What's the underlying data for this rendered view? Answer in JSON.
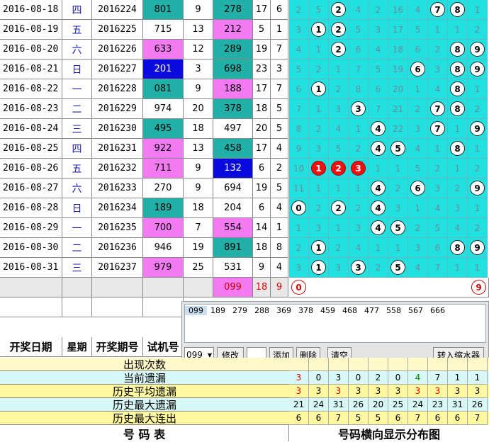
{
  "rows": [
    {
      "date": "2016-08-18",
      "wk": "四",
      "issue": "2016224",
      "test": "801",
      "s1": "9",
      "pick": "278",
      "s2": "17",
      "s3": "6",
      "cells": [
        "2",
        "5",
        "2",
        "4",
        "2",
        "16",
        "4",
        "7",
        "8",
        "1"
      ],
      "balls": [
        2,
        7,
        8
      ],
      "hl_test": "t",
      "hl_pick": "t"
    },
    {
      "date": "2016-08-19",
      "wk": "五",
      "issue": "2016225",
      "test": "715",
      "s1": "13",
      "pick": "212",
      "s2": "5",
      "s3": "1",
      "cells": [
        "3",
        "1",
        "2",
        "5",
        "3",
        "17",
        "5",
        "1",
        "1",
        "2"
      ],
      "balls": [
        1,
        2
      ],
      "hl_test": "",
      "hl_pick": "p"
    },
    {
      "date": "2016-08-20",
      "wk": "六",
      "issue": "2016226",
      "test": "633",
      "s1": "12",
      "pick": "289",
      "s2": "19",
      "s3": "7",
      "cells": [
        "4",
        "1",
        "2",
        "6",
        "4",
        "18",
        "6",
        "2",
        "8",
        "9"
      ],
      "balls": [
        2,
        8,
        9
      ],
      "hl_test": "p",
      "hl_pick": "t"
    },
    {
      "date": "2016-08-21",
      "wk": "日",
      "issue": "2016227",
      "test": "201",
      "s1": "3",
      "pick": "698",
      "s2": "23",
      "s3": "3",
      "cells": [
        "5",
        "2",
        "1",
        "7",
        "5",
        "19",
        "6",
        "3",
        "8",
        "9"
      ],
      "balls": [
        6,
        8,
        9
      ],
      "hl_test": "b",
      "hl_pick": "t"
    },
    {
      "date": "2016-08-22",
      "wk": "一",
      "issue": "2016228",
      "test": "081",
      "s1": "9",
      "pick": "188",
      "s2": "17",
      "s3": "7",
      "cells": [
        "6",
        "1",
        "2",
        "8",
        "6",
        "20",
        "1",
        "4",
        "8",
        "1"
      ],
      "balls": [
        1,
        8
      ],
      "hl_test": "t",
      "hl_pick": "p"
    },
    {
      "date": "2016-08-23",
      "wk": "二",
      "issue": "2016229",
      "test": "974",
      "s1": "20",
      "pick": "378",
      "s2": "18",
      "s3": "5",
      "cells": [
        "7",
        "1",
        "3",
        "3",
        "7",
        "21",
        "2",
        "7",
        "8",
        "2"
      ],
      "balls": [
        3,
        7,
        8
      ],
      "hl_test": "",
      "hl_pick": "t"
    },
    {
      "date": "2016-08-24",
      "wk": "三",
      "issue": "2016230",
      "test": "495",
      "s1": "18",
      "pick": "497",
      "s2": "20",
      "s3": "5",
      "cells": [
        "8",
        "2",
        "4",
        "1",
        "4",
        "22",
        "3",
        "7",
        "1",
        "9"
      ],
      "balls": [
        4,
        7,
        9
      ],
      "hl_test": "t",
      "hl_pick": ""
    },
    {
      "date": "2016-08-25",
      "wk": "四",
      "issue": "2016231",
      "test": "922",
      "s1": "13",
      "pick": "458",
      "s2": "17",
      "s3": "4",
      "cells": [
        "9",
        "3",
        "5",
        "2",
        "4",
        "5",
        "4",
        "1",
        "8",
        "1"
      ],
      "balls": [
        4,
        5,
        8
      ],
      "hl_test": "p",
      "hl_pick": "t"
    },
    {
      "date": "2016-08-26",
      "wk": "五",
      "issue": "2016232",
      "test": "711",
      "s1": "9",
      "pick": "132",
      "s2": "6",
      "s3": "2",
      "cells": [
        "10",
        "1",
        "2",
        "3",
        "1",
        "1",
        "5",
        "2",
        "1",
        "2"
      ],
      "balls": [
        1,
        2,
        3
      ],
      "hl_test": "p",
      "hl_pick": "b",
      "redballs": true
    },
    {
      "date": "2016-08-27",
      "wk": "六",
      "issue": "2016233",
      "test": "270",
      "s1": "9",
      "pick": "694",
      "s2": "19",
      "s3": "5",
      "cells": [
        "11",
        "1",
        "1",
        "1",
        "4",
        "2",
        "6",
        "3",
        "2",
        "9"
      ],
      "balls": [
        4,
        6,
        9
      ],
      "hl_test": "",
      "hl_pick": ""
    },
    {
      "date": "2016-08-28",
      "wk": "日",
      "issue": "2016234",
      "test": "189",
      "s1": "18",
      "pick": "204",
      "s2": "6",
      "s3": "4",
      "cells": [
        "0",
        "2",
        "2",
        "2",
        "4",
        "3",
        "1",
        "4",
        "3",
        "1"
      ],
      "balls": [
        0,
        2,
        4
      ],
      "hl_test": "t",
      "hl_pick": ""
    },
    {
      "date": "2016-08-29",
      "wk": "一",
      "issue": "2016235",
      "test": "700",
      "s1": "7",
      "pick": "554",
      "s2": "14",
      "s3": "1",
      "cells": [
        "1",
        "3",
        "1",
        "3",
        "4",
        "5",
        "2",
        "5",
        "4",
        "2"
      ],
      "balls": [
        4,
        5
      ],
      "hl_test": "p",
      "hl_pick": "p"
    },
    {
      "date": "2016-08-30",
      "wk": "二",
      "issue": "2016236",
      "test": "946",
      "s1": "19",
      "pick": "891",
      "s2": "18",
      "s3": "8",
      "cells": [
        "2",
        "1",
        "2",
        "4",
        "1",
        "1",
        "3",
        "6",
        "8",
        "9"
      ],
      "balls": [
        1,
        8,
        9
      ],
      "hl_test": "",
      "hl_pick": "t"
    },
    {
      "date": "2016-08-31",
      "wk": "三",
      "issue": "2016237",
      "test": "979",
      "s1": "25",
      "pick": "531",
      "s2": "9",
      "s3": "4",
      "cells": [
        "3",
        "1",
        "3",
        "3",
        "2",
        "5",
        "4",
        "7",
        "1",
        "1"
      ],
      "balls": [
        1,
        3,
        5
      ],
      "hl_test": "p",
      "hl_pick": ""
    }
  ],
  "prediction": {
    "pick": "099",
    "s2": "18",
    "s3": "9",
    "ball0": "0",
    "ball9": "9"
  },
  "headers": {
    "date": "开奖日期",
    "wk": "星期",
    "issue": "开奖期号",
    "test": "试机号"
  },
  "panel": {
    "items": [
      "099",
      "189",
      "279",
      "288",
      "369",
      "378",
      "459",
      "468",
      "477",
      "558",
      "567",
      "666"
    ],
    "combo_value": "099",
    "btn_modify": "修改",
    "btn_add": "添加",
    "btn_delete": "删除",
    "btn_clear": "清空",
    "btn_shrink": "转入缩水器"
  },
  "stats": [
    {
      "label": "出现次数",
      "values": [
        "",
        "",
        "",
        "",
        "",
        "",
        "",
        "",
        "",
        ""
      ],
      "bg": "#fff8c8"
    },
    {
      "label": "当前遗漏",
      "values": [
        "3",
        "0",
        "3",
        "0",
        "2",
        "0",
        "4",
        "7",
        "1",
        "1"
      ],
      "bg": "#d8f8f8",
      "colors": [
        "#d00",
        "#000",
        "#000",
        "#000",
        "#000",
        "#000",
        "#080",
        "#000",
        "#000",
        "#000"
      ]
    },
    {
      "label": "历史平均遗漏",
      "values": [
        "3",
        "3",
        "3",
        "3",
        "3",
        "3",
        "3",
        "3",
        "3",
        "3"
      ],
      "bg": "#fff8a0",
      "colors": [
        "#d00",
        "#000",
        "#d00",
        "#000",
        "#000",
        "#000",
        "#d00",
        "#d00",
        "#000",
        "#000"
      ]
    },
    {
      "label": "历史最大遗漏",
      "values": [
        "21",
        "24",
        "31",
        "26",
        "20",
        "25",
        "24",
        "23",
        "31",
        "26"
      ],
      "bg": "#d8f8f8"
    },
    {
      "label": "历史最大连出",
      "values": [
        "6",
        "6",
        "7",
        "5",
        "5",
        "6",
        "7",
        "6",
        "6",
        "7"
      ],
      "bg": "#fff8a0"
    }
  ],
  "footer": {
    "left": "号  码  表",
    "right": "号码横向显示分布图"
  }
}
